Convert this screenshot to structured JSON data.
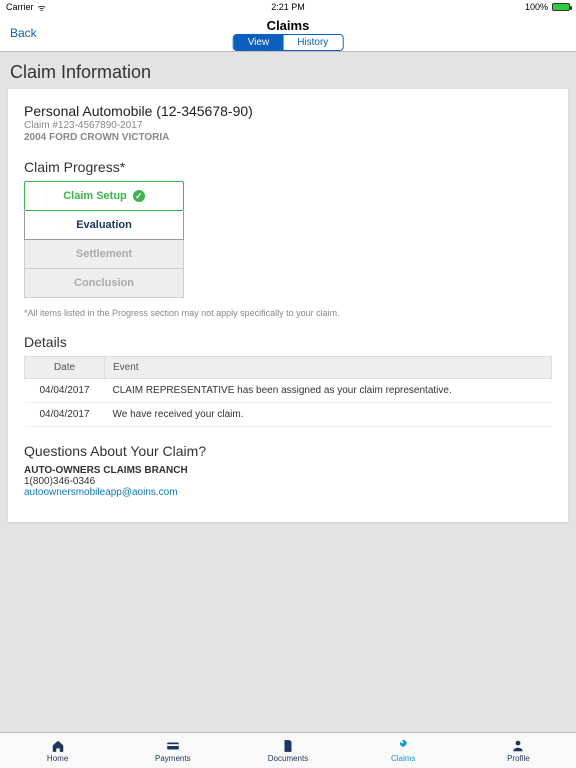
{
  "status": {
    "carrier": "Carrier",
    "wifi": "✓",
    "time": "2:21 PM",
    "battery": "100%"
  },
  "nav": {
    "title": "Claims",
    "back": "Back",
    "seg_view": "View",
    "seg_history": "History"
  },
  "page": {
    "title": "Claim Information"
  },
  "claim": {
    "type_line": "Personal Automobile (12-345678-90)",
    "number": "Claim #123-4567890-2017",
    "vehicle": "2004 FORD CROWN VICTORIA"
  },
  "progress": {
    "heading": "Claim Progress*",
    "steps": {
      "setup": "Claim Setup",
      "evaluation": "Evaluation",
      "settlement": "Settlement",
      "conclusion": "Conclusion"
    },
    "disclaimer": "*All items listed in the Progress section may not apply specifically to your claim."
  },
  "details": {
    "heading": "Details",
    "col_date": "Date",
    "col_event": "Event",
    "rows": [
      {
        "date": "04/04/2017",
        "event": "CLAIM REPRESENTATIVE has been assigned as your claim representative."
      },
      {
        "date": "04/04/2017",
        "event": "We have received your claim."
      }
    ]
  },
  "contact": {
    "heading": "Questions About Your Claim?",
    "branch": "AUTO-OWNERS CLAIMS BRANCH",
    "phone": "1(800)346-0346",
    "email": "autoownersmobileapp@aoins.com"
  },
  "tabs": {
    "home": "Home",
    "payments": "Payments",
    "documents": "Documents",
    "claims": "Claims",
    "profile": "Profile"
  }
}
